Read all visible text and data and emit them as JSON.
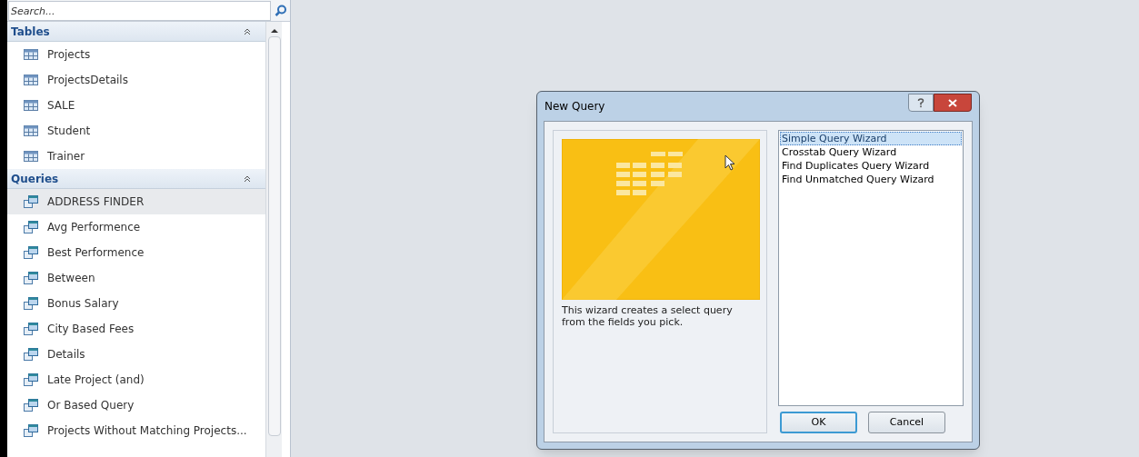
{
  "navigation_pane": {
    "search": {
      "placeholder": "Search..."
    },
    "groups": [
      {
        "title": "Tables",
        "kind": "table",
        "expanded": true,
        "items": [
          {
            "label": "Projects",
            "hovered": false
          },
          {
            "label": "ProjectsDetails",
            "hovered": false
          },
          {
            "label": "SALE",
            "hovered": false
          },
          {
            "label": "Student",
            "hovered": false
          },
          {
            "label": "Trainer",
            "hovered": false
          }
        ]
      },
      {
        "title": "Queries",
        "kind": "query",
        "expanded": true,
        "items": [
          {
            "label": "ADDRESS FINDER",
            "hovered": true
          },
          {
            "label": "Avg Performence",
            "hovered": false
          },
          {
            "label": "Best Performence",
            "hovered": false
          },
          {
            "label": "Between",
            "hovered": false
          },
          {
            "label": "Bonus Salary",
            "hovered": false
          },
          {
            "label": "City Based Fees",
            "hovered": false
          },
          {
            "label": "Details",
            "hovered": false
          },
          {
            "label": "Late Project (and)",
            "hovered": false
          },
          {
            "label": "Or Based Query",
            "hovered": false
          },
          {
            "label": "Projects Without Matching Projects...",
            "hovered": false
          }
        ]
      }
    ]
  },
  "dialog": {
    "title": "New Query",
    "description": "This wizard creates a select query from the fields you pick.",
    "wizards": [
      {
        "label": "Simple Query Wizard",
        "selected": true
      },
      {
        "label": "Crosstab Query Wizard",
        "selected": false
      },
      {
        "label": "Find Duplicates Query Wizard",
        "selected": false
      },
      {
        "label": "Find Unmatched Query Wizard",
        "selected": false
      }
    ],
    "buttons": [
      {
        "label": "OK",
        "default": true
      },
      {
        "label": "Cancel",
        "default": false
      }
    ]
  }
}
